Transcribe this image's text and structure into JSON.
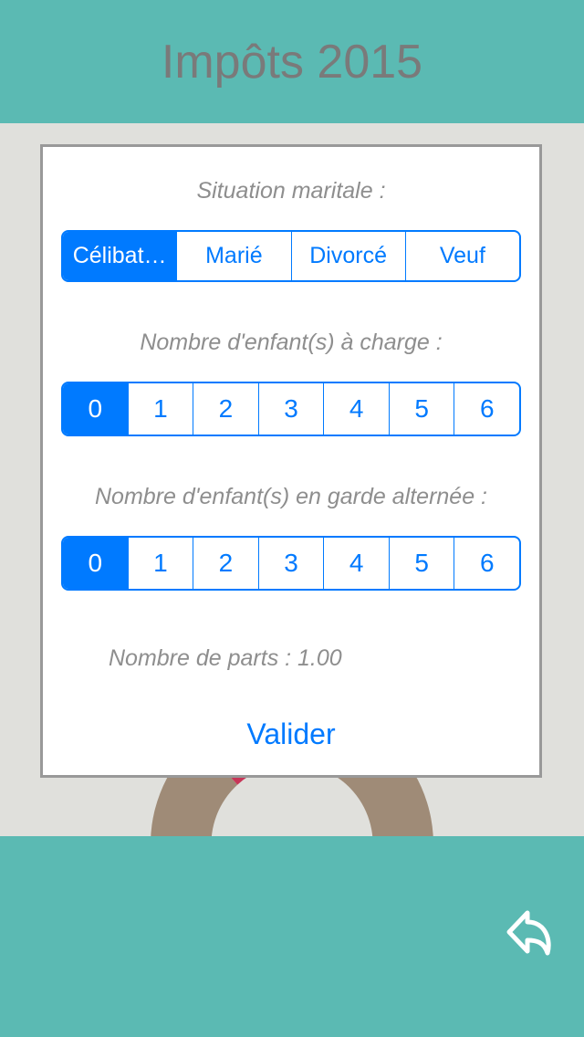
{
  "header": {
    "title": "Impôts 2015"
  },
  "modal": {
    "marital_label": "Situation maritale :",
    "marital_options": [
      "Célibat…",
      "Marié",
      "Divorcé",
      "Veuf"
    ],
    "marital_selected": 0,
    "children_label": "Nombre d'enfant(s) à charge :",
    "children_options": [
      "0",
      "1",
      "2",
      "3",
      "4",
      "5",
      "6"
    ],
    "children_selected": 0,
    "custody_label": "Nombre d'enfant(s) en garde alternée :",
    "custody_options": [
      "0",
      "1",
      "2",
      "3",
      "4",
      "5",
      "6"
    ],
    "custody_selected": 0,
    "parts_label": "Nombre de parts : 1.00",
    "validate_label": "Valider"
  },
  "chart_data": {
    "type": "pie",
    "title": "",
    "series": [
      {
        "name": "segment-main",
        "value": 88,
        "color": "#9f8b77"
      },
      {
        "name": "segment-accent",
        "value": 12,
        "color": "#c73658"
      }
    ]
  },
  "colors": {
    "teal": "#5bbab3",
    "blue": "#007aff",
    "donut_tan": "#9f8b77",
    "donut_red": "#c73658"
  }
}
